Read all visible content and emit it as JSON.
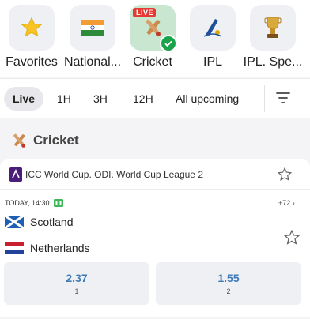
{
  "categories": [
    {
      "label": "Favorites",
      "icon": "star-icon"
    },
    {
      "label": "National...",
      "icon": "india-flag-icon"
    },
    {
      "label": "Cricket",
      "icon": "cricket-icon",
      "badge": "LIVE",
      "selected": true
    },
    {
      "label": "IPL",
      "icon": "ipl-logo-icon"
    },
    {
      "label": "IPL. Spe...",
      "icon": "trophy-icon"
    }
  ],
  "filters": {
    "options": [
      "Live",
      "1H",
      "3H",
      "12H",
      "All upcoming"
    ],
    "active": "Live"
  },
  "section": {
    "title": "Cricket"
  },
  "league": {
    "name": "ICC World Cup. ODI. World Cup League 2"
  },
  "match": {
    "time": "TODAY, 14:30",
    "more_markets": "+72",
    "teams": [
      {
        "name": "Scotland",
        "flag": "scotland-flag-icon"
      },
      {
        "name": "Netherlands",
        "flag": "netherlands-flag-icon"
      }
    ],
    "odds": [
      {
        "value": "2.37",
        "label": "1"
      },
      {
        "value": "1.55",
        "label": "2"
      }
    ]
  },
  "colors": {
    "accent_green": "#1aa34a",
    "live_red": "#e53935",
    "odds_blue": "#3e7bb6",
    "league_purple": "#4a1d7a"
  }
}
